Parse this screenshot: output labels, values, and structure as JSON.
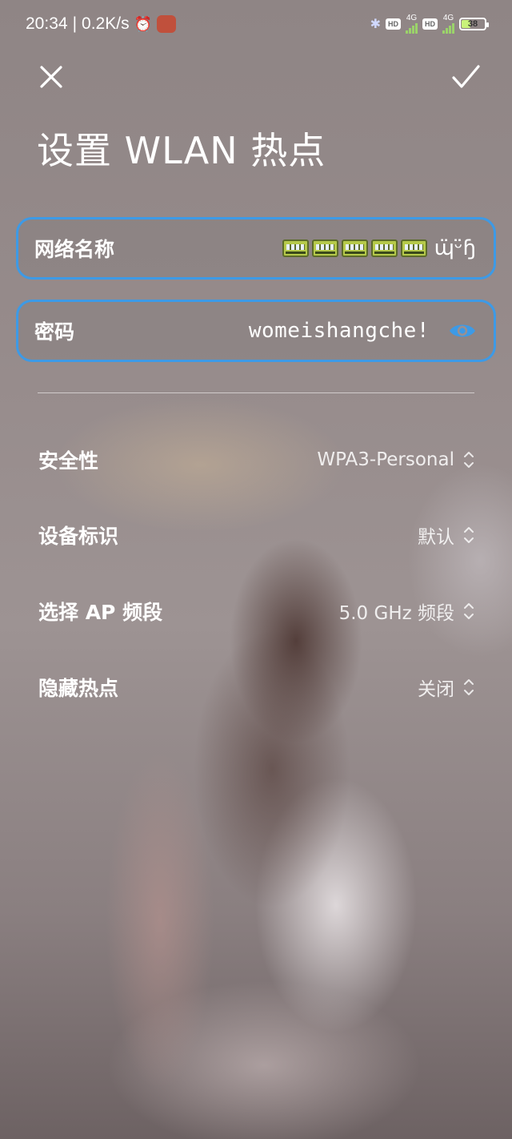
{
  "status_bar": {
    "time": "20:34",
    "speed": "0.2K/s",
    "network_1": "4G",
    "network_2": "4G",
    "hd_label": "HD",
    "battery_level": "38"
  },
  "header": {
    "title": "设置 WLAN 热点",
    "close_icon": "close-icon",
    "confirm_icon": "check-icon"
  },
  "ssid_field": {
    "label": "网络名称",
    "suffix": "ɰ̈ᵕ̈ɧ",
    "emoji_icon": "train-icon",
    "emoji_count": 5
  },
  "password_field": {
    "label": "密码",
    "value": "womeishangche!",
    "eye_icon": "eye-icon"
  },
  "settings": [
    {
      "label": "安全性",
      "value": "WPA3-Personal"
    },
    {
      "label": "设备标识",
      "value": "默认"
    },
    {
      "label": "选择 AP 频段",
      "value": "5.0 GHz 频段"
    },
    {
      "label": "隐藏热点",
      "value": "关闭"
    }
  ],
  "colors": {
    "accent": "#3d9ae6",
    "text": "#ffffff"
  }
}
